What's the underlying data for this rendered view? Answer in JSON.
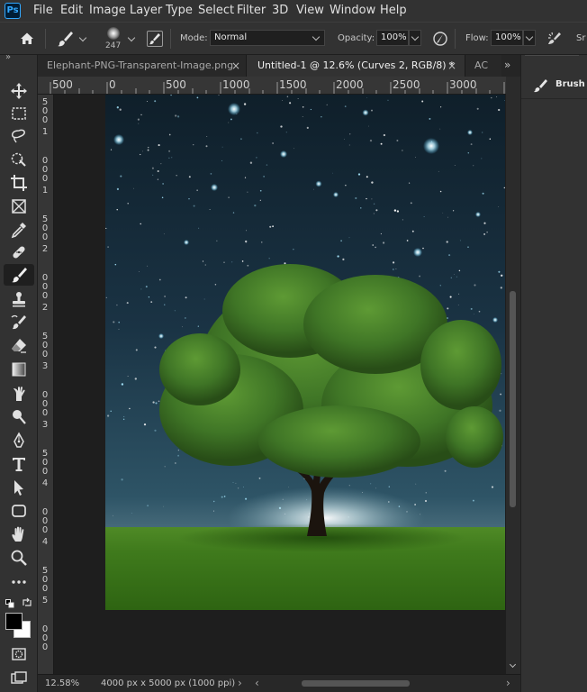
{
  "app": {
    "logo": "Ps"
  },
  "menu": [
    "File",
    "Edit",
    "Image",
    "Layer",
    "Type",
    "Select",
    "Filter",
    "3D",
    "View",
    "Window",
    "Help"
  ],
  "options": {
    "brush_size": "247",
    "mode_label": "Mode:",
    "mode_value": "Normal",
    "opacity_label": "Opacity:",
    "opacity_value": "100%",
    "flow_label": "Flow:",
    "flow_value": "100%",
    "smoothing_label": "Sr"
  },
  "tabs": [
    {
      "label": "Elephant-PNG-Transparent-Image.png",
      "active": false
    },
    {
      "label": "Untitled-1 @ 12.6% (Curves 2, RGB/8) *",
      "active": true
    },
    {
      "label": "AC",
      "active": false
    }
  ],
  "ruler": {
    "h_labels": [
      "500",
      "0",
      "500",
      "1000",
      "1500",
      "2000",
      "2500",
      "3000"
    ],
    "v_labels": [
      "5",
      "0",
      "0",
      "1",
      "0",
      "0",
      "0",
      "1",
      "5",
      "0",
      "0",
      "2",
      "0",
      "0",
      "0",
      "2",
      "5",
      "0",
      "0",
      "3",
      "0",
      "0",
      "0",
      "3",
      "5",
      "0",
      "0",
      "4",
      "0",
      "0",
      "0",
      "4",
      "5",
      "0",
      "0",
      "5",
      "0",
      "0",
      "0"
    ]
  },
  "status": {
    "zoom": "12.58%",
    "doc_info": "4000 px x 5000 px (1000 ppi)"
  },
  "panel": {
    "brush_settings_label": "Brush S"
  },
  "colors": {
    "foreground": "#000000",
    "background": "#ffffff",
    "accent": "#31a8ff"
  }
}
